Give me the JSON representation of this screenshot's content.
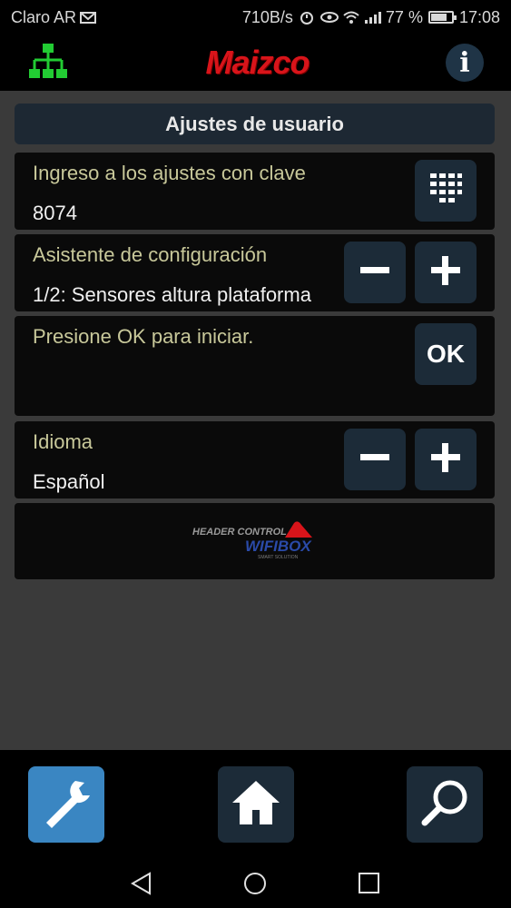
{
  "status_bar": {
    "carrier": "Claro AR",
    "speed": "710B/s",
    "battery": "77 %",
    "battery_level": 0.77,
    "time": "17:08"
  },
  "header": {
    "logo_text": "Maizco",
    "info_label": "i"
  },
  "main": {
    "title": "Ajustes de usuario",
    "panels": [
      {
        "label": "Ingreso a los ajustes con clave",
        "value": "8074"
      },
      {
        "label": "Asistente de configuración",
        "value": "1/2: Sensores altura plataforma"
      },
      {
        "label": "Presione OK para iniciar.",
        "button": "OK"
      },
      {
        "label": "Idioma",
        "value": "Español"
      }
    ],
    "brand_logo": {
      "line1": "HEADER CONTROL",
      "line2": "WIFIBOX",
      "line3": "SMART SOLUTION"
    }
  },
  "colors": {
    "accent": "#3a86c2",
    "button": "#1c2b38",
    "logo": "#d8141a",
    "network_icon": "#22cc33"
  }
}
